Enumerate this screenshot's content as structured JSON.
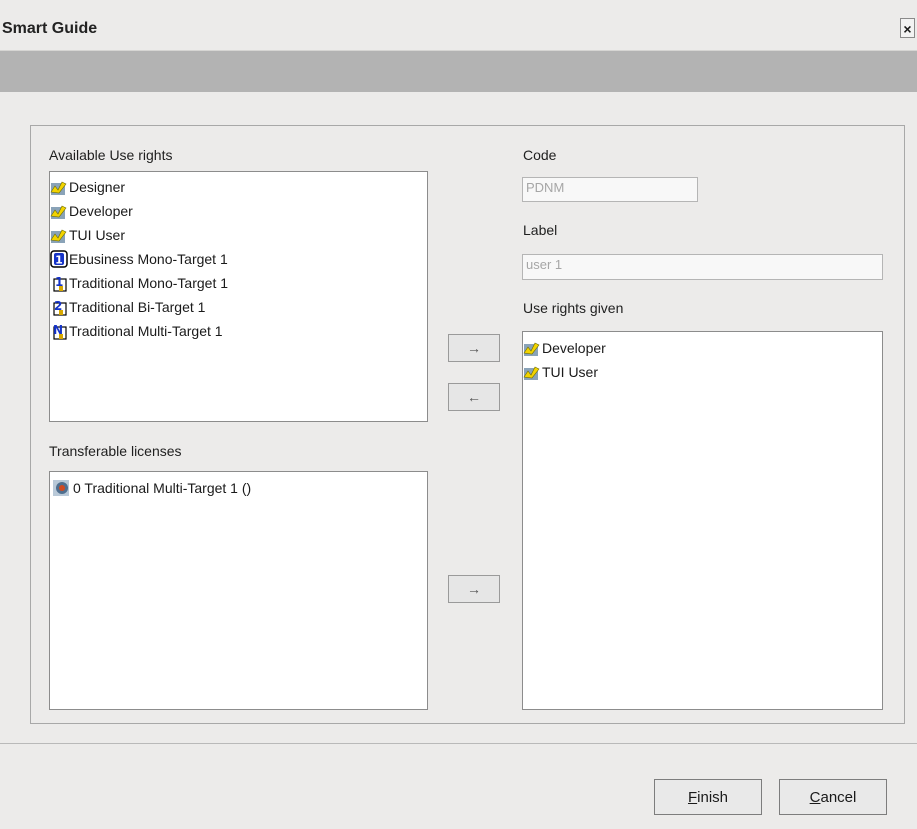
{
  "window": {
    "title": "Smart Guide",
    "close_label": "×"
  },
  "available": {
    "label": "Available Use rights",
    "items": [
      {
        "text": "Designer",
        "icon": "user-right-icon"
      },
      {
        "text": "Developer",
        "icon": "user-right-icon"
      },
      {
        "text": "TUI User",
        "icon": "user-right-icon"
      },
      {
        "text": "Ebusiness Mono-Target 1",
        "icon": "license-1-icon"
      },
      {
        "text": "Traditional Mono-Target 1",
        "icon": "mono-target-icon"
      },
      {
        "text": "Traditional Bi-Target 1",
        "icon": "bi-target-icon"
      },
      {
        "text": "Traditional Multi-Target 1",
        "icon": "multi-target-icon"
      }
    ]
  },
  "transferable": {
    "label": "Transferable licenses",
    "items": [
      {
        "text": "0 Traditional Multi-Target 1 ()",
        "icon": "transfer-license-icon"
      }
    ]
  },
  "arrows": {
    "add": "→",
    "remove": "←",
    "add_license": "→"
  },
  "code": {
    "label": "Code",
    "value": "PDNM"
  },
  "label_field": {
    "label": "Label",
    "value": "user 1"
  },
  "given": {
    "label": "Use rights given",
    "items": [
      {
        "text": "Developer",
        "icon": "user-right-icon"
      },
      {
        "text": "TUI User",
        "icon": "user-right-icon"
      }
    ]
  },
  "buttons": {
    "finish": {
      "mnemonic": "F",
      "rest": "inish"
    },
    "cancel": {
      "mnemonic": "C",
      "rest": "ancel"
    }
  }
}
